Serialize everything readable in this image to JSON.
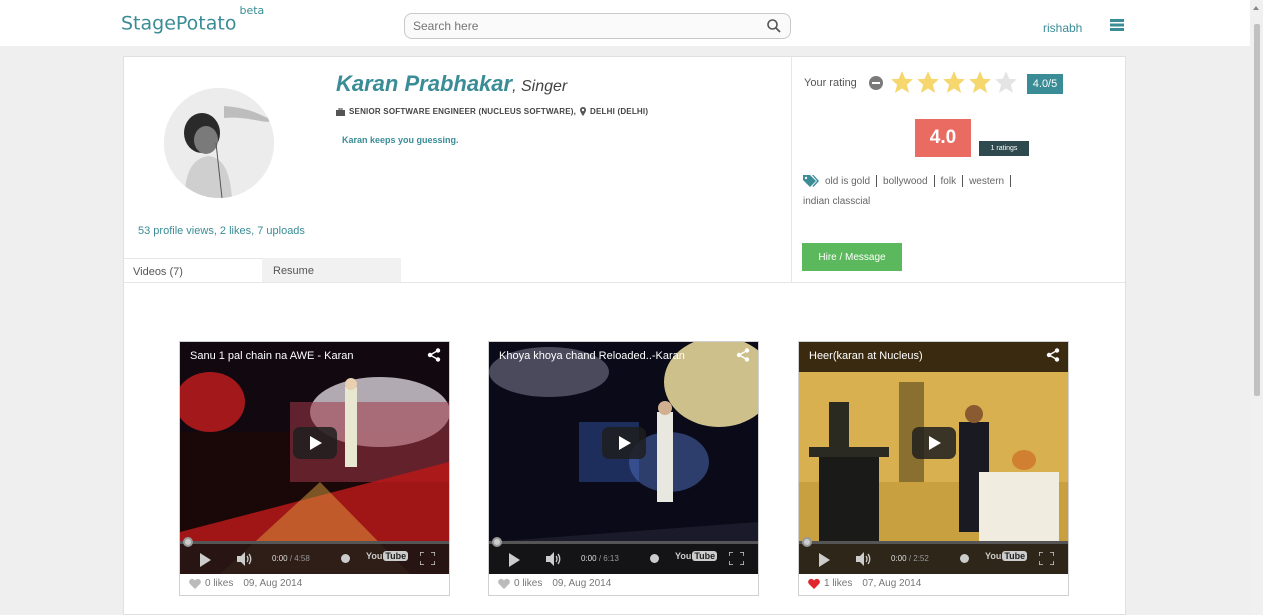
{
  "header": {
    "logo": "StagePotato",
    "logo_badge": "beta",
    "search_placeholder": "Search here",
    "username": "rishabh",
    "menu_icon": "list-icon"
  },
  "profile": {
    "name": "Karan Prabhakar",
    "role": ", Singer",
    "job": "SENIOR SOFTWARE ENGINEER (NUCLEUS SOFTWARE),",
    "location": "DELHI (DELHI)",
    "tagline": "Karan keeps you guessing.",
    "stats": "53 profile views, 2 likes, 7 uploads"
  },
  "tabs": [
    {
      "label": "Videos (7)",
      "active": true
    },
    {
      "label": "Resume",
      "active": false
    }
  ],
  "rating": {
    "label": "Your rating",
    "stars_filled": 4,
    "stars_total": 5,
    "badge": "4.0/5",
    "score": "4.0",
    "count": "1 ratings"
  },
  "tags": [
    "old is gold",
    "bollywood",
    "folk",
    "western",
    "indian classcial"
  ],
  "hire_button": "Hire / Message",
  "videos": [
    {
      "title": "Sanu 1 pal chain na AWE - Karan",
      "time": "0:00",
      "duration": "/ 4:58",
      "likes": "0 likes",
      "date": "09, Aug 2014",
      "liked": false
    },
    {
      "title": "Khoya khoya chand Reloaded..-Karan",
      "time": "0:00",
      "duration": "/ 6:13",
      "likes": "0 likes",
      "date": "09, Aug 2014",
      "liked": false
    },
    {
      "title": "Heer(karan at Nucleus)",
      "time": "0:00",
      "duration": "/ 2:52",
      "likes": "1 likes",
      "date": "07, Aug 2014",
      "liked": true
    }
  ],
  "player": {
    "yt_you": "You",
    "yt_tube": "Tube"
  },
  "colors": {
    "accent": "#3a8c96",
    "score_bg": "#e96b61",
    "hire_bg": "#5cb85c",
    "star": "#f5d76e",
    "like_active": "#e0262c"
  }
}
